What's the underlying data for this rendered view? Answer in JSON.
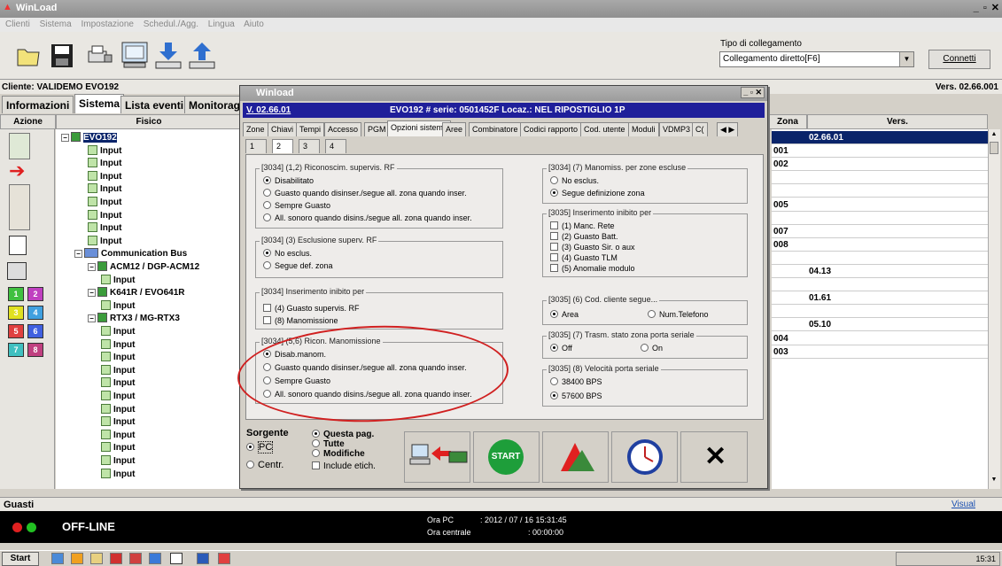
{
  "window": {
    "title": "WinLoad",
    "controls": "_ ▫ ✕"
  },
  "menu": [
    "Clienti",
    "Sistema",
    "Impostazione",
    "Schedul./Agg.",
    "Lingua",
    "Aiuto"
  ],
  "toolbar": {
    "icons": [
      "folder-icon",
      "save-icon",
      "printer-icon",
      "computer-icon",
      "download-icon",
      "upload-icon"
    ]
  },
  "connection": {
    "label": "Tipo di collegamento",
    "value": "Collegamento diretto[F6]",
    "button": "Connetti"
  },
  "client": {
    "label": "Cliente: VALIDEMO EVO192",
    "version": "Vers. 02.66.001"
  },
  "main_tabs": [
    "Informazioni",
    "Sistema",
    "Lista eventi",
    "Monitoragg"
  ],
  "columns": {
    "azione": "Azione",
    "fisico": "Fisico",
    "zona": "Zona",
    "vers": "Vers."
  },
  "tree": [
    {
      "label": "EVO192",
      "level": 0
    },
    {
      "label": "Input",
      "level": 2
    },
    {
      "label": "Input",
      "level": 2
    },
    {
      "label": "Input",
      "level": 2
    },
    {
      "label": "Input",
      "level": 2
    },
    {
      "label": "Input",
      "level": 2
    },
    {
      "label": "Input",
      "level": 2
    },
    {
      "label": "Input",
      "level": 2
    },
    {
      "label": "Input",
      "level": 2
    },
    {
      "label": "Communication Bus",
      "level": 1
    },
    {
      "label": "ACM12 / DGP-ACM12",
      "level": 2
    },
    {
      "label": "Input",
      "level": 3
    },
    {
      "label": "K641R / EVO641R",
      "level": 2
    },
    {
      "label": "Input",
      "level": 3
    },
    {
      "label": "RTX3 / MG-RTX3",
      "level": 2
    },
    {
      "label": "Input",
      "level": 3
    },
    {
      "label": "Input",
      "level": 3
    },
    {
      "label": "Input",
      "level": 3
    },
    {
      "label": "Input",
      "level": 3
    },
    {
      "label": "Input",
      "level": 3
    },
    {
      "label": "Input",
      "level": 3
    },
    {
      "label": "Input",
      "level": 3
    },
    {
      "label": "Input",
      "level": 3
    },
    {
      "label": "Input",
      "level": 3
    },
    {
      "label": "Input",
      "level": 3
    },
    {
      "label": "Input",
      "level": 3
    },
    {
      "label": "Input",
      "level": 3
    }
  ],
  "zone_grid": [
    {
      "zona": "",
      "vers": "02.66.01",
      "selected": true
    },
    {
      "zona": "001",
      "vers": ""
    },
    {
      "zona": "002",
      "vers": ""
    },
    {
      "zona": "",
      "vers": ""
    },
    {
      "zona": "",
      "vers": ""
    },
    {
      "zona": "005",
      "vers": ""
    },
    {
      "zona": "",
      "vers": ""
    },
    {
      "zona": "007",
      "vers": ""
    },
    {
      "zona": "008",
      "vers": ""
    },
    {
      "zona": "",
      "vers": ""
    },
    {
      "zona": "",
      "vers": "04.13"
    },
    {
      "zona": "",
      "vers": ""
    },
    {
      "zona": "",
      "vers": "01.61"
    },
    {
      "zona": "",
      "vers": ""
    },
    {
      "zona": "",
      "vers": "05.10"
    },
    {
      "zona": "004",
      "vers": ""
    },
    {
      "zona": "003",
      "vers": ""
    }
  ],
  "partition_buttons": [
    "1",
    "2",
    "3",
    "4",
    "5",
    "6",
    "7",
    "8"
  ],
  "dialog": {
    "title": "Winload",
    "version_link": "V. 02.66.01",
    "header": "EVO192 # serie: 0501452F Locaz.: NEL RIPOSTIGLIO 1P",
    "tabs": [
      "Zone",
      "Chiavi",
      "Tempi",
      "Accesso",
      "PGM",
      "Opzioni sistema",
      "Aree",
      "Combinatore",
      "Codici rapporto",
      "Cod. utente",
      "Moduli",
      "VDMP3",
      "C("
    ],
    "subtabs": [
      "1",
      "2",
      "3",
      "4"
    ],
    "groups": {
      "g1": {
        "title": "[3034]  (1,2) Riconoscim. supervis. RF",
        "options": [
          "Disabilitato",
          "Guasto quando disinser./segue all. zona quando inser.",
          "Sempre Guasto",
          "All. sonoro quando disins./segue all. zona quando inser."
        ]
      },
      "g2": {
        "title": "[3034]  (3)  Esclusione superv. RF",
        "options": [
          "No esclus.",
          "Segue def. zona"
        ]
      },
      "g3": {
        "title": "[3034]  Inserimento inibito per",
        "options": [
          "(4) Guasto supervis. RF",
          "(8) Manomissione"
        ]
      },
      "g4": {
        "title": "[3034]  (5,6) Ricon. Manomissione",
        "options": [
          "Disab.manom.",
          "Guasto quando disinser./segue all. zona quando inser.",
          "Sempre Guasto",
          "All. sonoro quando disins./segue all. zona quando inser."
        ]
      },
      "g5": {
        "title": "[3034] (7)  Manomiss. per zone escluse",
        "options": [
          "No esclus.",
          "Segue definizione zona"
        ]
      },
      "g6": {
        "title": "[3035]  Inserimento inibito per",
        "options": [
          "(1) Manc. Rete",
          "(2) Guasto Batt.",
          "(3) Guasto Sir. o aux",
          "(4) Guasto TLM",
          "(5) Anomalie modulo"
        ]
      },
      "g7": {
        "title": "[3035] (6)  Cod. cliente segue...",
        "options": [
          "Area",
          "Num.Telefono"
        ]
      },
      "g8": {
        "title": "[3035] (7)  Trasm. stato zona porta seriale",
        "options": [
          "Off",
          "On"
        ]
      },
      "g9": {
        "title": "[3035] (8)  Velocità porta seriale",
        "options": [
          "38400 BPS",
          "57600 BPS"
        ]
      }
    },
    "sorgente": {
      "label": "Sorgente",
      "pc": "PC",
      "centr": "Centr."
    },
    "pages": {
      "questa": "Questa pag.",
      "tutte": "Tutte",
      "modifiche": "Modifiche",
      "include": "Include etich."
    },
    "start": "START",
    "close": "✕"
  },
  "guasti": {
    "label": "Guasti",
    "visual": "Visual"
  },
  "status": {
    "state": "OFF-LINE",
    "pc_label": "Ora PC",
    "pc_value": ": 2012 / 07 / 16  15:31:45",
    "central_label": "Ora centrale",
    "central_value": ":  00:00:00"
  },
  "taskbar": {
    "start": "Start",
    "clock": "15:31"
  }
}
